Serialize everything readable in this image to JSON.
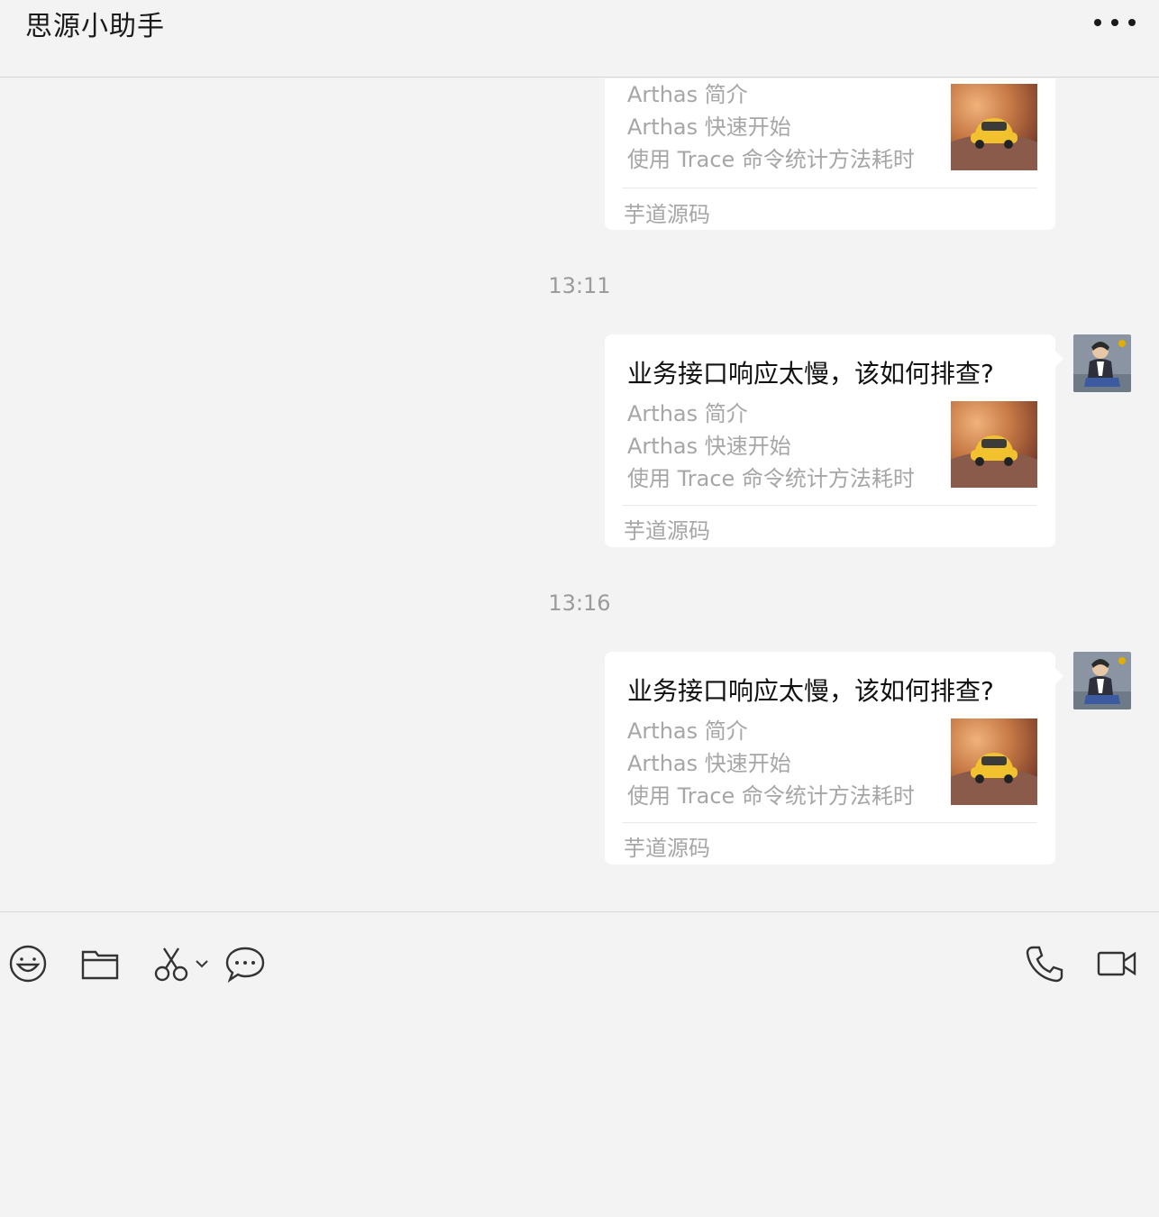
{
  "header": {
    "title": "思源小助手",
    "more_icon": "more-dots-icon"
  },
  "messages": [
    {
      "kind": "card",
      "title": "",
      "lines": [
        "Arthas 简介",
        "Arthas 快速开始",
        "使用 Trace 命令统计方法耗时"
      ],
      "source": "芋道源码"
    },
    {
      "kind": "timestamp",
      "text": "13:11"
    },
    {
      "kind": "card",
      "title": "业务接口响应太慢，该如何排查?",
      "lines": [
        "Arthas 简介",
        "Arthas 快速开始",
        "使用 Trace 命令统计方法耗时"
      ],
      "source": "芋道源码"
    },
    {
      "kind": "timestamp",
      "text": "13:16"
    },
    {
      "kind": "card",
      "title": "业务接口响应太慢，该如何排查?",
      "lines": [
        "Arthas 简介",
        "Arthas 快速开始",
        "使用 Trace 命令统计方法耗时"
      ],
      "source": "芋道源码"
    }
  ],
  "toolbar": {
    "left": [
      "emoji-icon",
      "folder-icon",
      "scissors-icon",
      "chat-history-icon"
    ],
    "right": [
      "phone-icon",
      "video-call-icon"
    ]
  },
  "colors": {
    "background": "#f3f3f3",
    "card": "#ffffff",
    "muted_text": "#a6a6a6",
    "primary_text": "#111111"
  }
}
